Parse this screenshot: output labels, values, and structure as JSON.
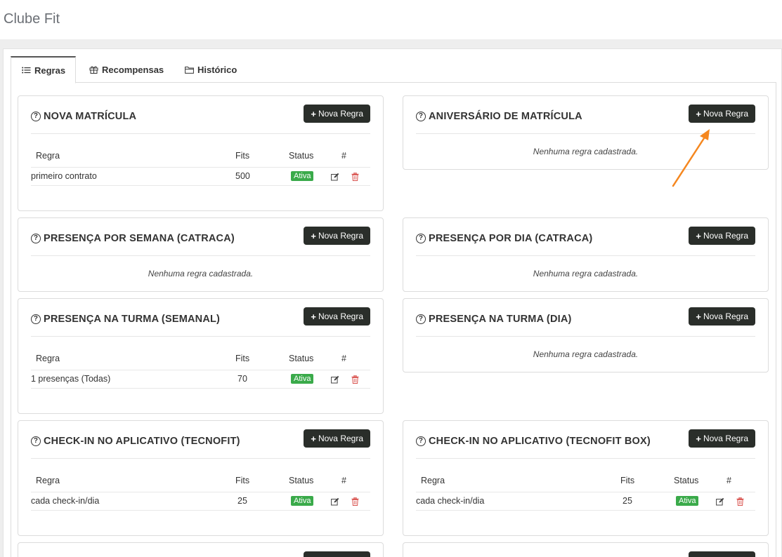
{
  "app": {
    "title": "Clube Fit"
  },
  "tabs": [
    {
      "label": "Regras",
      "icon": "list-icon",
      "active": true
    },
    {
      "label": "Recompensas",
      "icon": "gift-icon",
      "active": false
    },
    {
      "label": "Histórico",
      "icon": "folder-icon",
      "active": false
    }
  ],
  "common": {
    "new_rule_label": "Nova Regra",
    "empty_text": "Nenhuma regra cadastrada.",
    "col_rule": "Regra",
    "col_fits": "Fits",
    "col_status": "Status",
    "col_actions": "#",
    "active_label": "Ativa"
  },
  "cards": [
    {
      "title": "NOVA MATRÍCULA",
      "rows": [
        {
          "rule": "primeiro contrato",
          "fits": "500",
          "status": "Ativa"
        }
      ]
    },
    {
      "title": "ANIVERSÁRIO DE MATRÍCULA",
      "rows": []
    },
    {
      "title": "PRESENÇA POR SEMANA (CATRACA)",
      "rows": []
    },
    {
      "title": "PRESENÇA POR DIA (CATRACA)",
      "rows": []
    },
    {
      "title": "PRESENÇA NA TURMA (SEMANAL)",
      "rows": [
        {
          "rule": "1 presenças (Todas)",
          "fits": "70",
          "status": "Ativa"
        }
      ]
    },
    {
      "title": "PRESENÇA NA TURMA (DIA)",
      "rows": []
    },
    {
      "title": "CHECK-IN NO APLICATIVO (TECNOFIT)",
      "rows": [
        {
          "rule": "cada check-in/dia",
          "fits": "25",
          "status": "Ativa"
        }
      ]
    },
    {
      "title": "CHECK-IN NO APLICATIVO (TECNOFIT BOX)",
      "rows": [
        {
          "rule": "cada check-in/dia",
          "fits": "25",
          "status": "Ativa"
        }
      ]
    }
  ],
  "colors": {
    "accent_button": "#2a2e2a",
    "badge_active": "#3aaa4a",
    "delete_icon": "#d9534f",
    "annotation_arrow": "#f5871f"
  }
}
